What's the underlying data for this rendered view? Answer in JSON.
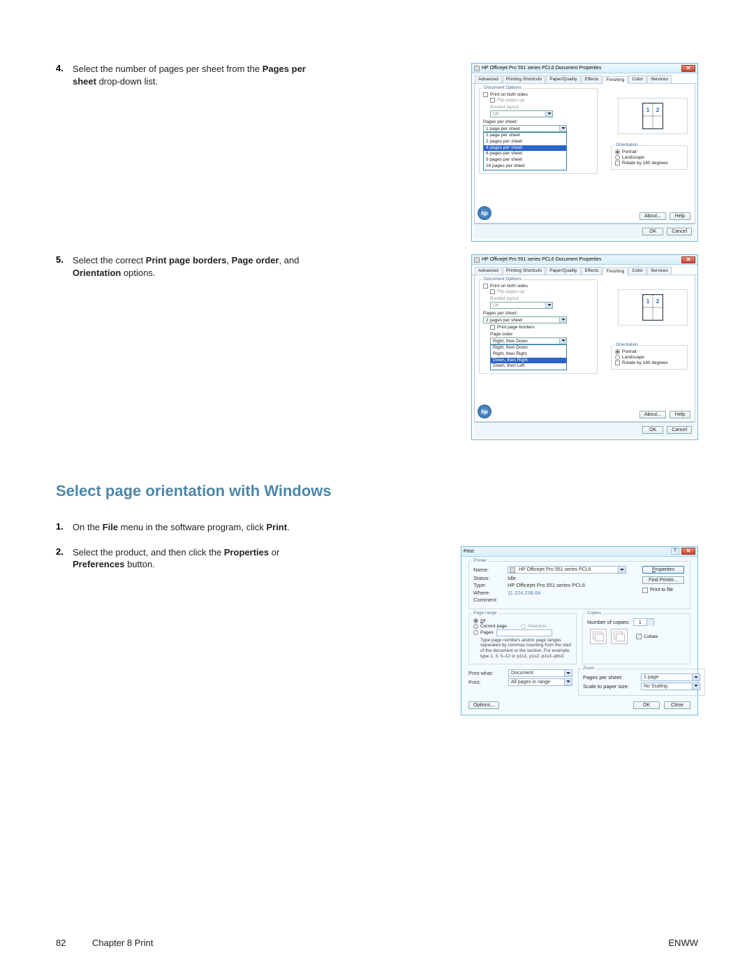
{
  "steps_a": {
    "s4": {
      "num": "4.",
      "text_a": "Select the number of pages per sheet from the ",
      "bold_a": "Pages per sheet",
      "text_b": " drop-down list."
    },
    "s5": {
      "num": "5.",
      "text_a": "Select the correct ",
      "bold_a": "Print page borders",
      "sep1": ", ",
      "bold_b": "Page order",
      "sep2": ", and ",
      "bold_c": "Orientation",
      "text_b": " options."
    }
  },
  "heading": "Select page orientation with Windows",
  "steps_b": {
    "s1": {
      "num": "1.",
      "t1": "On the ",
      "b1": "File",
      "t2": " menu in the software program, click ",
      "b2": "Print",
      "t3": "."
    },
    "s2": {
      "num": "2.",
      "t1": "Select the product, and then click the ",
      "b1": "Properties",
      "t2": " or ",
      "b2": "Preferences",
      "t3": " button."
    }
  },
  "dlg": {
    "title": "HP Officejet Pro 551 series PCL6 Document Properties",
    "tabs": [
      "Advanced",
      "Printing Shortcuts",
      "Paper/Quality",
      "Effects",
      "Finishing",
      "Color",
      "Services"
    ],
    "doc_options": "Document Options",
    "print_both_sides": "Print on both sides",
    "flip_pages_up": "Flip pages up",
    "booklet_layout": "Booklet layout:",
    "off": "Off",
    "pages_per_sheet": "Pages per sheet:",
    "pps_values": [
      "1 page per sheet",
      "2 pages per sheet",
      "4 pages per sheet",
      "6 pages per sheet",
      "9 pages per sheet",
      "16 pages per sheet"
    ],
    "pps_selected_idx": 0,
    "pps_highlight_idx": 2,
    "print_page_borders": "Print page borders",
    "page_order": "Page order:",
    "page_order_values": [
      "Right, then Down",
      "Right, then Right",
      "Down, then Right",
      "Down, then Left"
    ],
    "page_order_highlight_idx": 2,
    "pps_value_2": "2 pages per sheet",
    "orientation": "Orientation",
    "portrait": "Portrait",
    "landscape": "Landscape",
    "rotate180": "Rotate by 180 degrees",
    "about": "About...",
    "help": "Help",
    "ok": "OK",
    "cancel": "Cancel"
  },
  "print": {
    "title": "Print",
    "printer": "Printer",
    "name": "Name:",
    "name_val": "HP Officejet Pro 551 series PCL6",
    "status": "Status:",
    "status_val": "Idle",
    "type": "Type:",
    "type_val": "HP Officejet Pro 551 series PCL6",
    "where": "Where:",
    "where_val": "11.224.238.64",
    "comment": "Comment:",
    "properties": "Properties",
    "find_printer": "Find Printer...",
    "print_to_file": "Print to file",
    "page_range": "Page range",
    "all": "All",
    "current_page": "Current page",
    "selection": "Selection",
    "pages": "Pages:",
    "range_help": "Type page numbers and/or page ranges separated by commas counting from the start of the document or the section. For example, type 1, 3, 5–12 or p1s1, p1s2, p1s3–p8s3",
    "copies": "Copies",
    "num_copies": "Number of copies:",
    "num_copies_val": "1",
    "collate": "Collate",
    "print_what": "Print what:",
    "print_what_val": "Document",
    "print": "Print:",
    "print_val": "All pages in range",
    "zoom": "Zoom",
    "pps": "Pages per sheet:",
    "pps_val": "1 page",
    "scale": "Scale to paper size:",
    "scale_val": "No Scaling",
    "options": "Options...",
    "ok": "OK",
    "close": "Close"
  },
  "footer": {
    "page": "82",
    "chapter": "Chapter 8   Print",
    "right": "ENWW"
  }
}
